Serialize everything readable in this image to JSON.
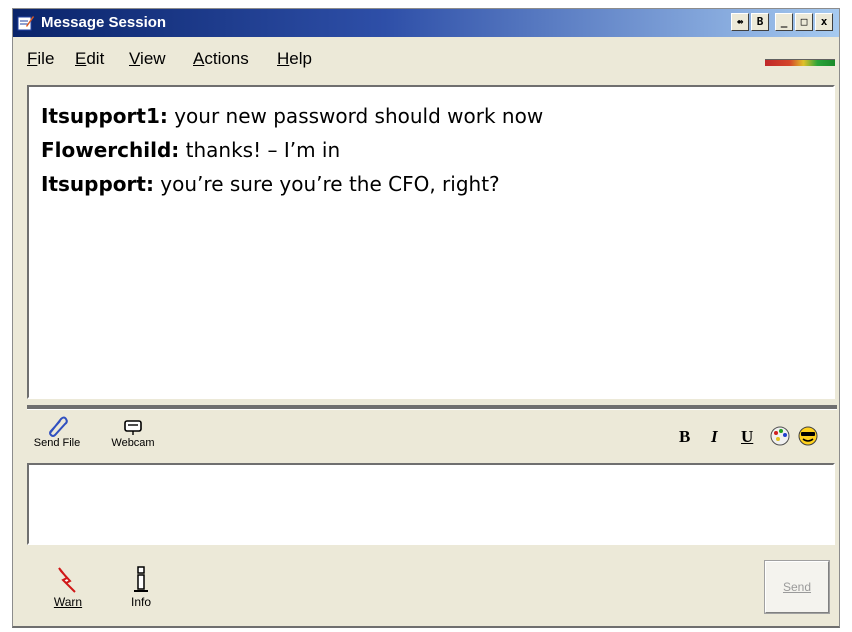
{
  "window": {
    "title": "Message Session",
    "title_buttons": {
      "pin": "⇴",
      "restore": "B",
      "minimize": "_",
      "maximize": "□",
      "close": "x"
    }
  },
  "menu": {
    "items": [
      {
        "accel": "F",
        "rest": "ile"
      },
      {
        "accel": "E",
        "rest": "dit"
      },
      {
        "accel": "V",
        "rest": "iew"
      },
      {
        "accel": "A",
        "rest": "ctions"
      },
      {
        "accel": "H",
        "rest": "elp"
      }
    ]
  },
  "transcript": {
    "messages": [
      {
        "sender": "Itsupport1:",
        "text": " your new password should work now"
      },
      {
        "sender": "Flowerchild:",
        "text": " thanks! – I’m in"
      },
      {
        "sender": "Itsupport:",
        "text": " you’re sure you’re the CFO, right?"
      }
    ]
  },
  "toolbar": {
    "send_file": "Send File",
    "webcam": "Webcam",
    "bold": "B",
    "italic": "I",
    "underline": "U"
  },
  "compose": {
    "value": ""
  },
  "bottom": {
    "warn": "Warn",
    "info": "Info",
    "send": "Send"
  },
  "colors": {
    "titlebar_start": "#0a246a",
    "titlebar_end": "#a6caf0",
    "window_bg": "#ece9d8"
  },
  "icons": {
    "title": "pencil-note-icon",
    "send_file": "paperclip-icon",
    "webcam": "webcam-icon",
    "colors": "palette-icon",
    "emoticon": "smiley-sunglasses-icon",
    "warn": "lightning-warn-icon",
    "info": "info-person-icon"
  }
}
